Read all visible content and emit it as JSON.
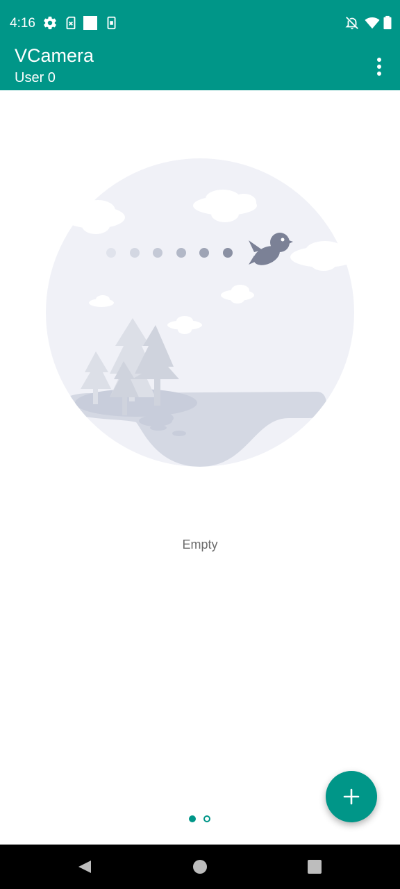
{
  "status_bar": {
    "time": "4:16",
    "left_icons": [
      "settings-icon",
      "sim-card-icon",
      "white-square-icon",
      "phone-icon"
    ],
    "right_icons": [
      "notifications-off-icon",
      "wifi-icon",
      "battery-icon"
    ]
  },
  "app_bar": {
    "title": "VCamera",
    "subtitle": "User 0",
    "overflow_icon": "more-vert-icon"
  },
  "main": {
    "empty_label": "Empty",
    "page_indicator": {
      "total": 2,
      "current": 1
    }
  },
  "fab": {
    "icon": "add-icon"
  },
  "nav_bar": {
    "buttons": [
      "back-icon",
      "home-icon",
      "recents-icon"
    ]
  },
  "colors": {
    "accent": "#009688",
    "illustration_bg": "#f0f1f7",
    "illustration_shape": "#d4d8e3",
    "bird": "#7b8196"
  }
}
